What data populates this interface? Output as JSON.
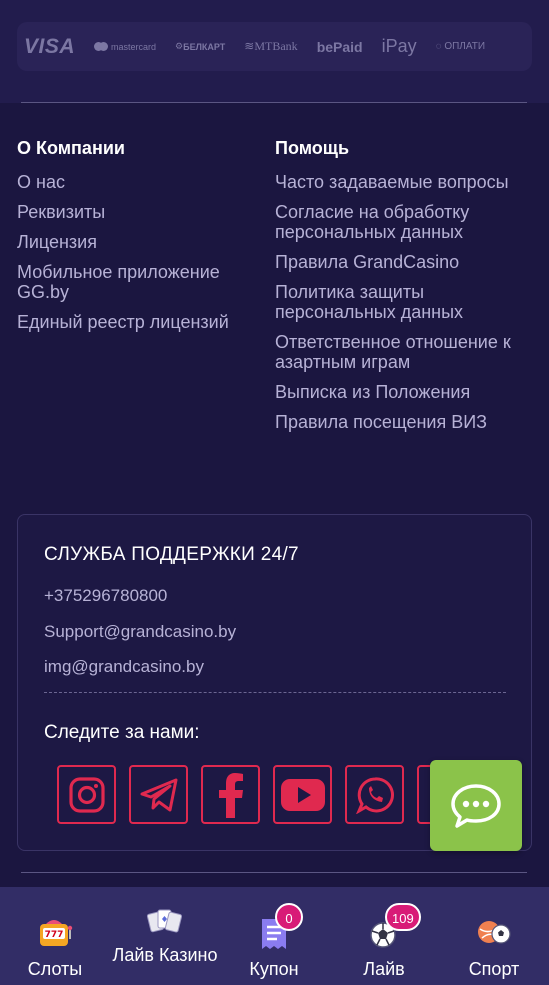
{
  "payments": {
    "logos": [
      "VISA",
      "mastercard",
      "БЕЛКАРТ",
      "MTBank",
      "bePaid",
      "iPay",
      "ОПЛАТИ"
    ]
  },
  "footer": {
    "company": {
      "title": "О Компании",
      "links": [
        "О нас",
        "Реквизиты",
        "Лицензия",
        "Мобильное приложение GG.by",
        "Единый реестр лицензий"
      ]
    },
    "help": {
      "title": "Помощь",
      "links": [
        "Часто задаваемые вопросы",
        "Согласие на обработку персональных данных",
        "Правила GrandCasino",
        "Политика защиты персональных данных",
        "Ответственное отношение к азартным играм",
        "Выписка из Положения",
        "Правила посещения ВИЗ"
      ]
    }
  },
  "support": {
    "title": "СЛУЖБА ПОДДЕРЖКИ 24/7",
    "phone": "+375296780800",
    "email_support": "Support@grandcasino.by",
    "email_img": "img@grandcasino.by",
    "follow_title": "Следите за нами:",
    "socials": [
      "instagram-icon",
      "telegram-icon",
      "facebook-icon",
      "youtube-icon",
      "whatsapp-icon",
      "vk-icon"
    ]
  },
  "chat": {
    "icon": "chat-bubble-icon",
    "color": "#8bc34a"
  },
  "bottom_nav": {
    "items": [
      {
        "label": "Слоты",
        "icon": "slot-machine-icon"
      },
      {
        "label": "Лайв Казино",
        "icon": "playing-cards-icon"
      },
      {
        "label": "Купон",
        "icon": "coupon-icon",
        "badge": "0"
      },
      {
        "label": "Лайв",
        "icon": "live-ball-icon",
        "badge": "109"
      },
      {
        "label": "Спорт",
        "icon": "sports-balls-icon"
      }
    ]
  },
  "colors": {
    "background": "#1b1640",
    "accent_red": "#e0294f",
    "badge_pink": "#d81b77",
    "nav_bg": "#322d66"
  }
}
